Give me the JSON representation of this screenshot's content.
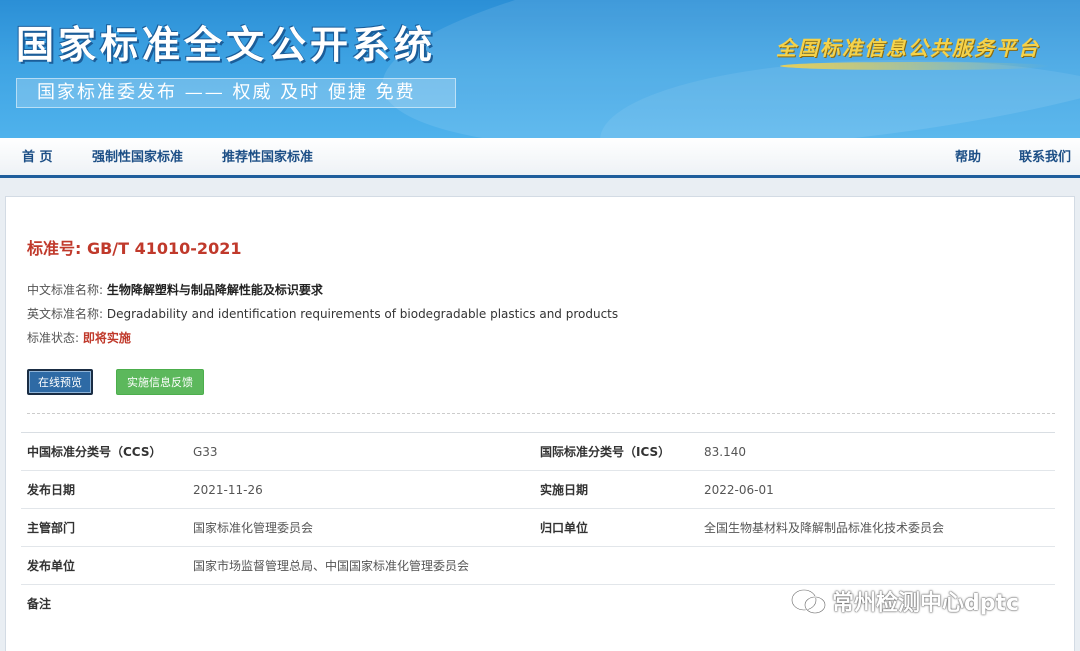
{
  "banner": {
    "title": "国家标准全文公开系统",
    "subtitle": "国家标准委发布 —— 权威 及时 便捷 免费",
    "platform": "全国标准信息公共服务平台"
  },
  "nav": {
    "home": "首 页",
    "mandatory": "强制性国家标准",
    "recommended": "推荐性国家标准",
    "help": "帮助",
    "contact": "联系我们"
  },
  "standard": {
    "number_label": "标准号: GB/T 41010-2021",
    "cn_name_label": "中文标准名称: ",
    "cn_name": "生物降解塑料与制品降解性能及标识要求",
    "en_name_label": "英文标准名称: ",
    "en_name": "Degradability and identification requirements of biodegradable plastics and products",
    "status_label": "标准状态: ",
    "status": "即将实施"
  },
  "buttons": {
    "preview": "在线预览",
    "feedback": "实施信息反馈"
  },
  "meta": {
    "ccs_label": "中国标准分类号（CCS）",
    "ccs": "G33",
    "ics_label": "国际标准分类号（ICS）",
    "ics": "83.140",
    "publish_date_label": "发布日期",
    "publish_date": "2021-11-26",
    "impl_date_label": "实施日期",
    "impl_date": "2022-06-01",
    "dept_label": "主管部门",
    "dept": "国家标准化管理委员会",
    "central_label": "归口单位",
    "central": "全国生物基材料及降解制品标准化技术委员会",
    "issuer_label": "发布单位",
    "issuer": "国家市场监督管理总局、中国国家标准化管理委员会",
    "remark_label": "备注",
    "remark": ""
  },
  "watermark": "常州检测中心dptc",
  "colors": {
    "banner": "#3ea3e3",
    "nav_text": "#1d4f86",
    "accent_red": "#c0392b",
    "preview_btn": "#2e6aa5",
    "feedback_btn": "#5cb85c"
  }
}
